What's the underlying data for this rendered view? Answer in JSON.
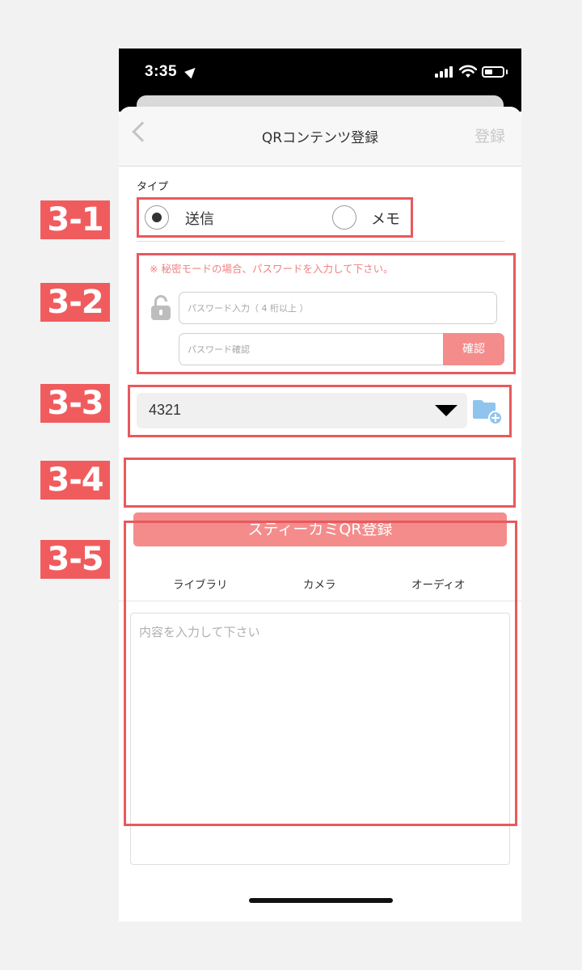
{
  "status_bar": {
    "time": "3:35"
  },
  "nav": {
    "title": "QRコンテンツ登録",
    "register_label": "登録"
  },
  "type_section": {
    "label": "タイプ",
    "options": [
      {
        "label": "送信",
        "selected": true
      },
      {
        "label": "メモ",
        "selected": false
      }
    ]
  },
  "password_section": {
    "notice": "※ 秘密モードの場合、パスワードを入力して下さい。",
    "password_placeholder": "パスワード入力（ 4 桁以上 ）",
    "confirm_placeholder": "パスワード確認",
    "confirm_button": "確認"
  },
  "folder_select": {
    "value": "4321"
  },
  "register_button": {
    "label": "スティーカミQR登録"
  },
  "content_tabs": [
    "ライブラリ",
    "カメラ",
    "オーディオ"
  ],
  "content_input": {
    "placeholder": "内容を入力して下さい"
  },
  "step_labels": [
    "3-1",
    "3-2",
    "3-3",
    "3-4",
    "3-5"
  ],
  "colors": {
    "accent": "#f48c8c",
    "annotation": "#e8595d",
    "notice": "#f08080"
  }
}
